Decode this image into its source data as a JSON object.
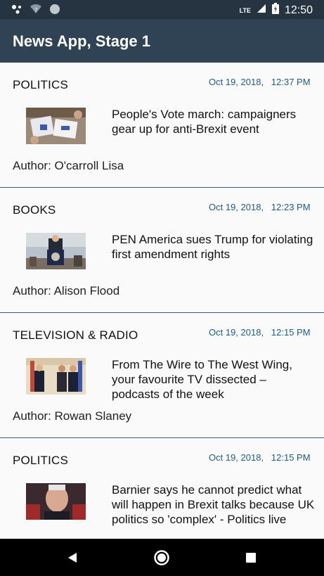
{
  "status_bar": {
    "network": "LTE",
    "time": "12:50",
    "icons": [
      "notification-dots-icon",
      "wifi-unknown-icon",
      "sync-circle-icon",
      "signal-icon",
      "battery-charging-icon"
    ]
  },
  "app_bar": {
    "title": "News App, Stage 1"
  },
  "articles": [
    {
      "section": "POLITICS",
      "date": "Oct 19, 2018,   12:37 PM",
      "headline": "People's Vote march: campaigners gear up for anti-Brexit event",
      "author": "Author: O'carroll Lisa"
    },
    {
      "section": "BOOKS",
      "date": "Oct 19, 2018,   12:23 PM",
      "headline": "PEN America sues Trump for violating first amendment rights",
      "author": "Author: Alison Flood"
    },
    {
      "section": "TELEVISION & RADIO",
      "date": "Oct 19, 2018,   12:15 PM",
      "headline": "From The Wire to The West Wing, your favourite TV dissected – podcasts of the week",
      "author": "Author: Rowan Slaney"
    },
    {
      "section": "POLITICS",
      "date": "Oct 19, 2018,   12:15 PM",
      "headline": "Barnier says he cannot predict what will happen in Brexit talks because UK politics so 'complex' - Politics live",
      "author": ""
    }
  ],
  "nav_bar": {
    "icons": [
      "back-icon",
      "home-icon",
      "recents-icon"
    ]
  },
  "colors": {
    "status_bar": "#263441",
    "app_bar": "#2f4354",
    "date_text": "#1e5a8c",
    "divider": "#3a5b73"
  }
}
